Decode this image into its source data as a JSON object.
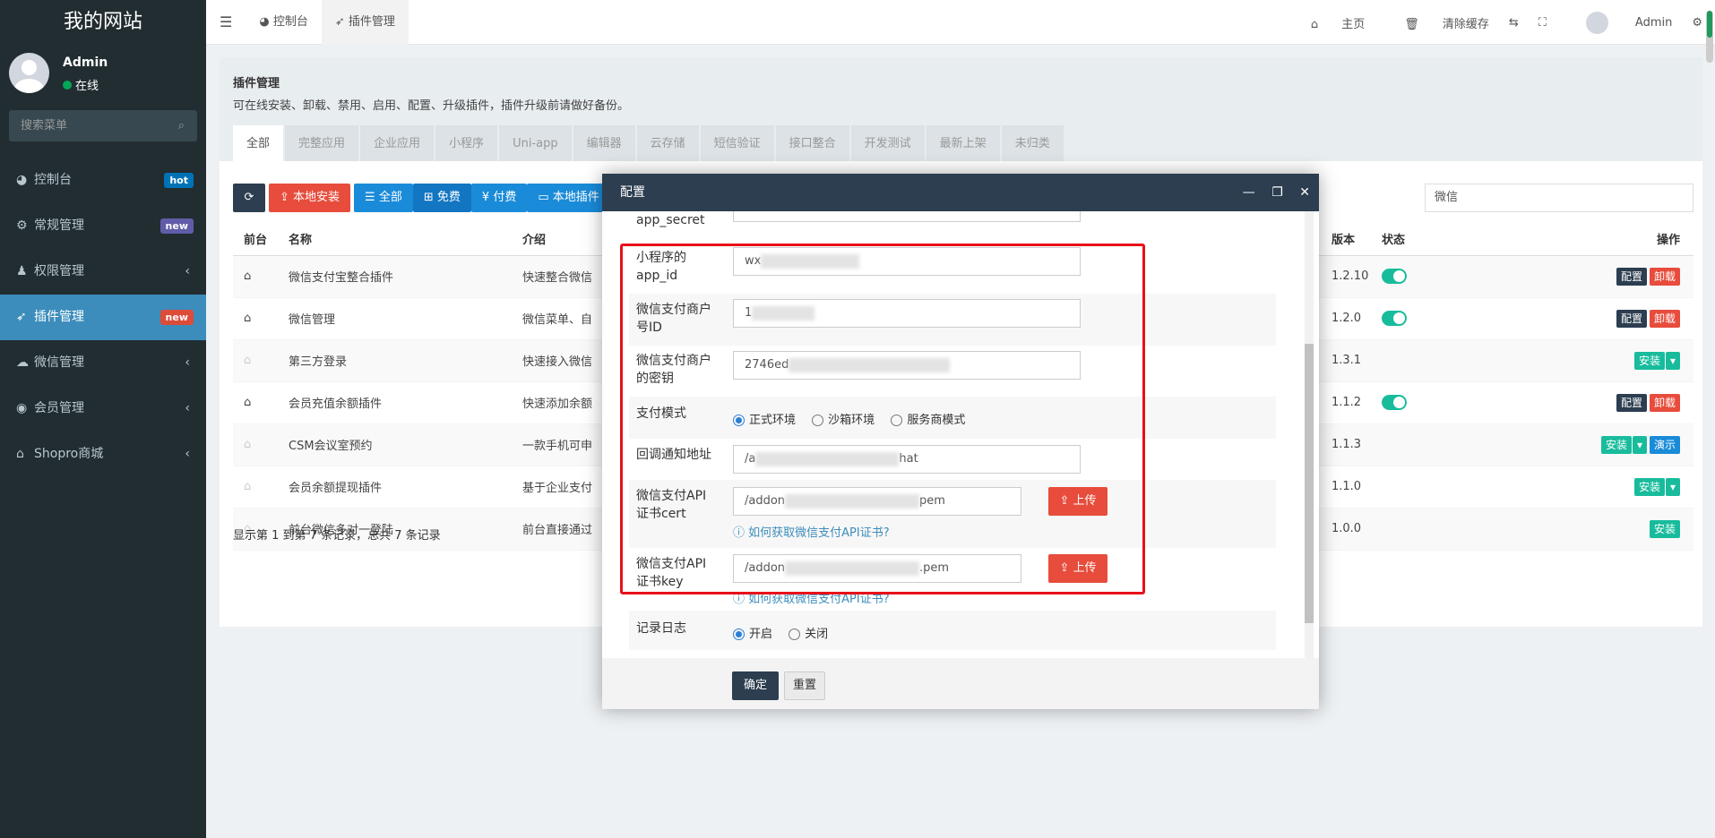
{
  "sidebar": {
    "site_title": "我的网站",
    "user_name": "Admin",
    "user_status": "在线",
    "search_placeholder": "搜索菜单",
    "items": [
      {
        "label": "控制台",
        "icon": "dashboard-icon",
        "badge": "hot",
        "badge_color": "#0073b7"
      },
      {
        "label": "常规管理",
        "icon": "cogs-icon",
        "badge": "new",
        "badge_color": "#605ca8"
      },
      {
        "label": "权限管理",
        "icon": "users-icon",
        "arrow": "‹"
      },
      {
        "label": "插件管理",
        "icon": "rocket-icon",
        "badge": "new",
        "badge_color": "#dd4b39",
        "active": true
      },
      {
        "label": "微信管理",
        "icon": "wechat-icon",
        "arrow": "‹"
      },
      {
        "label": "会员管理",
        "icon": "user-circle-icon",
        "arrow": "‹"
      },
      {
        "label": "Shopro商城",
        "icon": "home-icon",
        "arrow": "‹"
      }
    ]
  },
  "topbar": {
    "menu_icon": "☰",
    "tab_dashboard": "控制台",
    "tab_plugins": "插件管理",
    "home": "主页",
    "clear_cache": "清除缓存",
    "user": "Admin"
  },
  "header": {
    "title": "插件管理",
    "desc": "可在线安装、卸载、禁用、启用、配置、升级插件，插件升级前请做好备份。",
    "tabs": [
      "全部",
      "完整应用",
      "企业应用",
      "小程序",
      "Uni-app",
      "编辑器",
      "云存储",
      "短信验证",
      "接口整合",
      "开发测试",
      "最新上架",
      "未归类"
    ]
  },
  "toolbar": {
    "local_install": "本地安装",
    "all": "全部",
    "free": "免费",
    "paid": "付费",
    "local_plugins": "本地插件",
    "search_value": "微信"
  },
  "table": {
    "headers": {
      "front": "前台",
      "name": "名称",
      "intro": "介绍",
      "version": "版本",
      "status": "状态",
      "ops": "操作"
    },
    "rows": [
      {
        "name": "微信支付宝整合插件",
        "intro": "快速整合微信",
        "version": "1.2.10"
      },
      {
        "name": "微信管理",
        "intro": "微信菜单、自",
        "version": "1.2.0"
      },
      {
        "name": "第三方登录",
        "intro": "快速接入微信",
        "version": "1.3.1"
      },
      {
        "name": "会员充值余额插件",
        "intro": "快速添加余额",
        "version": "1.1.2"
      },
      {
        "name": "CSM会议室预约",
        "intro": "一款手机可申",
        "version": "1.1.3"
      },
      {
        "name": "会员余额提现插件",
        "intro": "基于企业支付",
        "version": "1.1.0"
      },
      {
        "name": "前台微信多对一登陆",
        "intro": "前台直接通过",
        "version": "1.0.0"
      }
    ],
    "btn_config": "配置",
    "btn_uninstall": "卸载",
    "btn_install": "安装",
    "btn_demo": "演示",
    "footer": "显示第 1 到第 7 条记录，总共 7 条记录"
  },
  "modal": {
    "title": "配置",
    "fields": {
      "app_secret": "app_secret",
      "miniapp_label": "小程序的app_id",
      "miniapp_value": "wx",
      "mch_label": "微信支付商户号ID",
      "mch_value": "1",
      "key_label": "微信支付商户的密钥",
      "key_value": "2746ed",
      "mode_label": "支付模式",
      "mode_options": [
        "正式环境",
        "沙箱环境",
        "服务商模式"
      ],
      "notify_label": "回调通知地址",
      "notify_value_start": "/a",
      "notify_value_end": "hat",
      "cert_label": "微信支付API证书cert",
      "cert_value_start": "/addon",
      "cert_value_end": "pem",
      "key2_label": "微信支付API证书key",
      "key2_value_start": "/addon",
      "key2_value_end": ".pem",
      "upload": "上传",
      "help_link": "如何获取微信支付API证书?",
      "log_label": "记录日志",
      "log_options": [
        "开启",
        "关闭"
      ]
    },
    "ok": "确定",
    "reset": "重置"
  }
}
